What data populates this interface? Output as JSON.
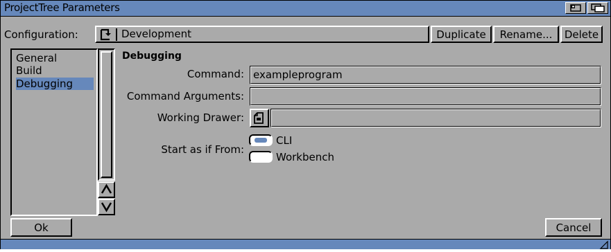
{
  "window": {
    "title": "ProjectTree Parameters"
  },
  "configuration": {
    "label": "Configuration:",
    "value": "Development",
    "duplicate_label": "Duplicate",
    "rename_label": "Rename...",
    "delete_label": "Delete"
  },
  "sidebar": {
    "items": [
      {
        "label": "General",
        "selected": false
      },
      {
        "label": "Build",
        "selected": false
      },
      {
        "label": "Debugging",
        "selected": true
      }
    ]
  },
  "debugging": {
    "heading": "Debugging",
    "command_label": "Command:",
    "command_value": "exampleprogram",
    "arguments_label": "Command Arguments:",
    "arguments_value": "",
    "drawer_label": "Working Drawer:",
    "drawer_value": "",
    "start_label": "Start as if From:",
    "start_options": [
      {
        "label": "CLI",
        "selected": true
      },
      {
        "label": "Workbench",
        "selected": false
      }
    ]
  },
  "footer": {
    "ok_label": "Ok",
    "cancel_label": "Cancel"
  },
  "colors": {
    "background": "#aaaaaa",
    "accent": "#6688bb"
  },
  "icons": {
    "cycle": "cycle-icon",
    "drawer": "drawer-icon",
    "depth": "depth-icon",
    "zoom": "zoom-icon",
    "scroll_up": "arrow-up-icon",
    "scroll_down": "arrow-down-icon",
    "sizing": "sizing-icon"
  }
}
